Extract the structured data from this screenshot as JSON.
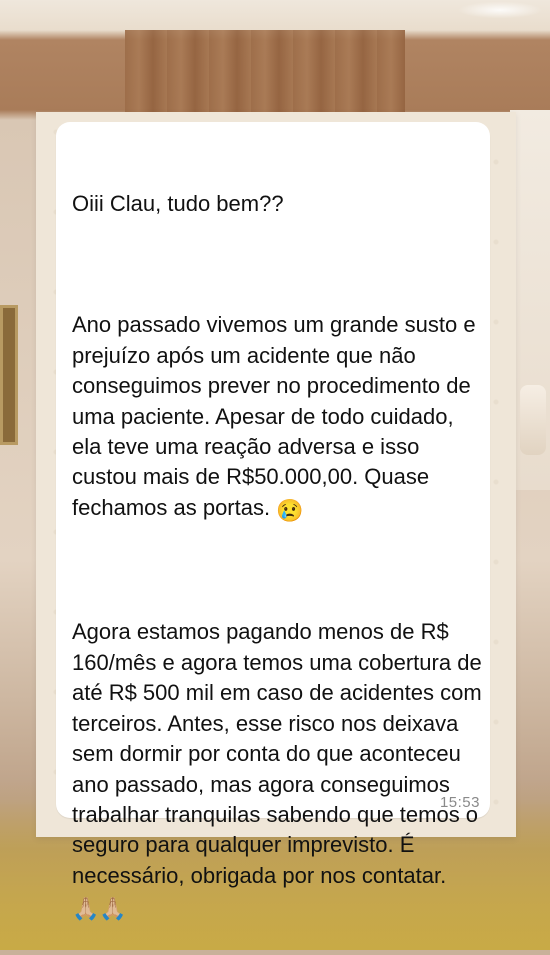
{
  "message": {
    "paragraphs": [
      "Oiii Clau, tudo bem??",
      "Ano passado vivemos um grande susto e prejuízo após um acidente que não conseguimos prever no procedimento de uma paciente. Apesar de todo cuidado, ela teve uma reação adversa e isso custou mais de R$50.000,00. Quase fechamos as portas.",
      "Agora estamos pagando menos de R$ 160/mês e agora temos uma cobertura de até R$ 500 mil em caso de acidentes com terceiros. Antes, esse risco nos deixava sem dormir por conta do que aconteceu ano passado, mas agora conseguimos trabalhar tranquilas sabendo que temos o seguro para qualquer imprevisto. É necessário, obrigada por nos contatar."
    ],
    "emoji_crying": "😢",
    "emoji_pray": "🙏🏼🙏🏼",
    "timestamp": "15:53"
  }
}
